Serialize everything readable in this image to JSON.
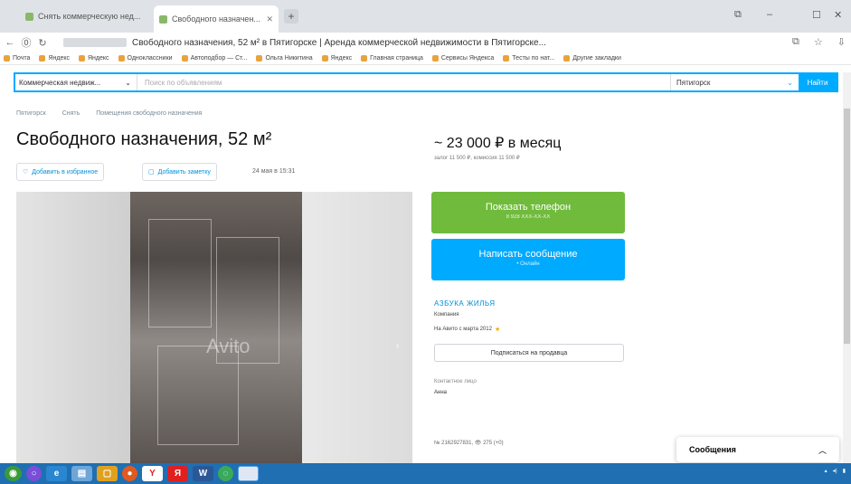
{
  "browser": {
    "tabs": [
      {
        "title": "Снять коммерческую нед...",
        "active": false
      },
      {
        "title": "Свободного назначен...",
        "active": true
      }
    ],
    "new_tab": "+",
    "address": "Свободного назначения, 52 м² в Пятигорске | Аренда коммерческой недвижимости в Пятигорске...",
    "bookmarks": [
      "Почта",
      "Яндекс",
      "Яндекс",
      "Одноклассники",
      "Автоподбор — Ст...",
      "Ольга Никитина",
      "Яндекс",
      "Главная страница",
      "Сервисы Яндекса",
      "Тесты по нат...",
      "Другие закладки"
    ]
  },
  "search": {
    "category": "Коммерческая недвиж...",
    "placeholder": "Поиск по объявлениям",
    "city": "Пятигорск",
    "submit": "Найти"
  },
  "breadcrumbs": [
    "Пятигорск",
    "Снять",
    "Помещения свободного назначения"
  ],
  "listing": {
    "title": "Свободного назначения, 52 м²",
    "favorite": "Добавить в избранное",
    "note": "Добавить заметку",
    "date": "24 мая в 15:31",
    "price": "~ 23 000 ₽ в месяц",
    "pledge": "залог 11 500 ₽, комиссия 11 500 ₽",
    "watermark": "Avito"
  },
  "actions": {
    "phone": "Показать телефон",
    "phone_sub": "8 928 XXX-XX-XX",
    "message": "Написать сообщение",
    "message_sub": "• Онлайн"
  },
  "seller": {
    "name": "АЗБУКА ЖИЛЬЯ",
    "type": "Компания",
    "since": "На Авито с марта 2012",
    "subscribe": "Подписаться на продавца",
    "contact_label": "Контактное лицо",
    "contact_name": "Анна"
  },
  "ad_number": "№ 2162927831, 👁 275 (+0)",
  "messages": {
    "label": "Сообщения",
    "icon": "chevron-up-icon"
  },
  "colors": {
    "accent": "#00aaff",
    "green": "#70bb3c",
    "taskbar": "#1f6fb2"
  }
}
